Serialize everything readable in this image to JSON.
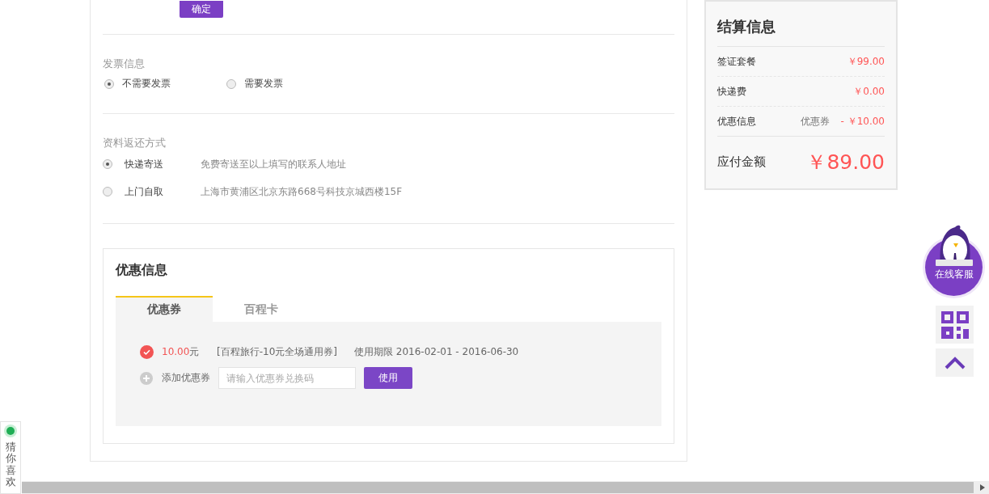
{
  "confirm_button": "确定",
  "invoice": {
    "title": "发票信息",
    "options": [
      {
        "label": "不需要发票",
        "selected": true
      },
      {
        "label": "需要发票",
        "selected": false
      }
    ]
  },
  "return_method": {
    "title": "资料返还方式",
    "options": [
      {
        "label": "快递寄送",
        "note": "免费寄送至以上填写的联系人地址",
        "selected": true
      },
      {
        "label": "上门自取",
        "note": "上海市黄浦区北京东路668号科技京城西楼15F",
        "selected": false
      }
    ]
  },
  "discount": {
    "title": "优惠信息",
    "tabs": [
      {
        "label": "优惠券",
        "selected": true
      },
      {
        "label": "百程卡",
        "selected": false
      }
    ],
    "coupons": [
      {
        "checked": true,
        "amount": "10.00",
        "unit": "元",
        "name": "[百程旅行-10元全场通用券]",
        "validity": "使用期限 2016-02-01 - 2016-06-30"
      }
    ],
    "add_label": "添加优惠券",
    "code_field": {
      "placeholder": "请输入优惠券兑换码"
    },
    "use_button": "使用"
  },
  "summary": {
    "title": "结算信息",
    "rows": [
      {
        "label": "签证套餐",
        "value": "￥99.00"
      },
      {
        "label": "快递费",
        "value": "￥0.00"
      },
      {
        "label": "优惠信息",
        "tag": "优惠券",
        "value": "- ￥10.00"
      }
    ],
    "total_label": "应付金额",
    "total": "￥89.00"
  },
  "support": {
    "label": "在线客服"
  },
  "side_tab": {
    "label": "猜你喜欢"
  }
}
